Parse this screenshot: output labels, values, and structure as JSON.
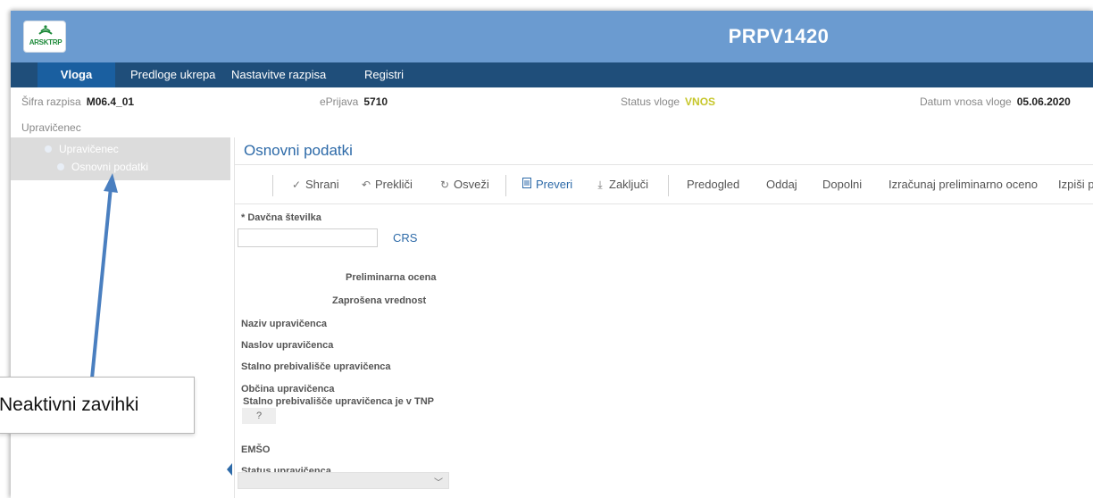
{
  "header": {
    "logo_text": "ARSKTRP",
    "title": "PRPV1420"
  },
  "nav": {
    "items": [
      {
        "label": "Vloga"
      },
      {
        "label": "Predloge ukrepa"
      },
      {
        "label": "Nastavitve razpisa"
      },
      {
        "label": "Registri"
      }
    ]
  },
  "info": {
    "sifra_label": "Šifra razpisa",
    "sifra_value": "M06.4_01",
    "eprijava_label": "ePrijava",
    "eprijava_value": "5710",
    "status_label": "Status vloge",
    "status_value": "VNOS",
    "datum_label": "Datum vnosa vloge",
    "datum_value": "05.06.2020",
    "subheading": "Upravičenec"
  },
  "sidebar": {
    "items": [
      {
        "label": "Upravičenec"
      },
      {
        "label": "Osnovni podatki"
      }
    ]
  },
  "main": {
    "section_title": "Osnovni podatki"
  },
  "toolbar": {
    "buttons": [
      {
        "label": "Shrani",
        "icon": "check-icon"
      },
      {
        "label": "Prekliči",
        "icon": "undo-icon"
      },
      {
        "label": "Osveži",
        "icon": "refresh-icon"
      },
      {
        "label": "Preveri",
        "icon": "document-icon"
      },
      {
        "label": "Zaključi",
        "icon": "download-icon"
      },
      {
        "label": "Predogled"
      },
      {
        "label": "Oddaj"
      },
      {
        "label": "Dopolni"
      },
      {
        "label": "Izračunaj preliminarno oceno"
      },
      {
        "label": "Izpiši p"
      }
    ]
  },
  "form": {
    "tax_label": "* Davčna številka",
    "tax_value": "",
    "crs_link": "CRS",
    "prelim_label": "Preliminarna ocena",
    "zaprosena_label": "Zaprošena vrednost",
    "naziv_label": "Naziv upravičenca",
    "naslov_label": "Naslov upravičenca",
    "stalno_label": "Stalno prebivališče upravičenca",
    "obcina_label": "Občina upravičenca",
    "tnp_label": "Stalno prebivališče upravičenca je v TNP",
    "tnp_value": "?",
    "emso_label": "EMŠO",
    "status_label": "Status upravičenca",
    "status_value": ""
  },
  "annotation": {
    "callout_text": "Neaktivni zavihki"
  },
  "colors": {
    "header_blue": "#6b9bd0",
    "nav_dark": "#1f4e7a",
    "nav_active": "#1a5fa0",
    "link_blue": "#2d6aa8",
    "status_yellow": "#c6c62a"
  }
}
